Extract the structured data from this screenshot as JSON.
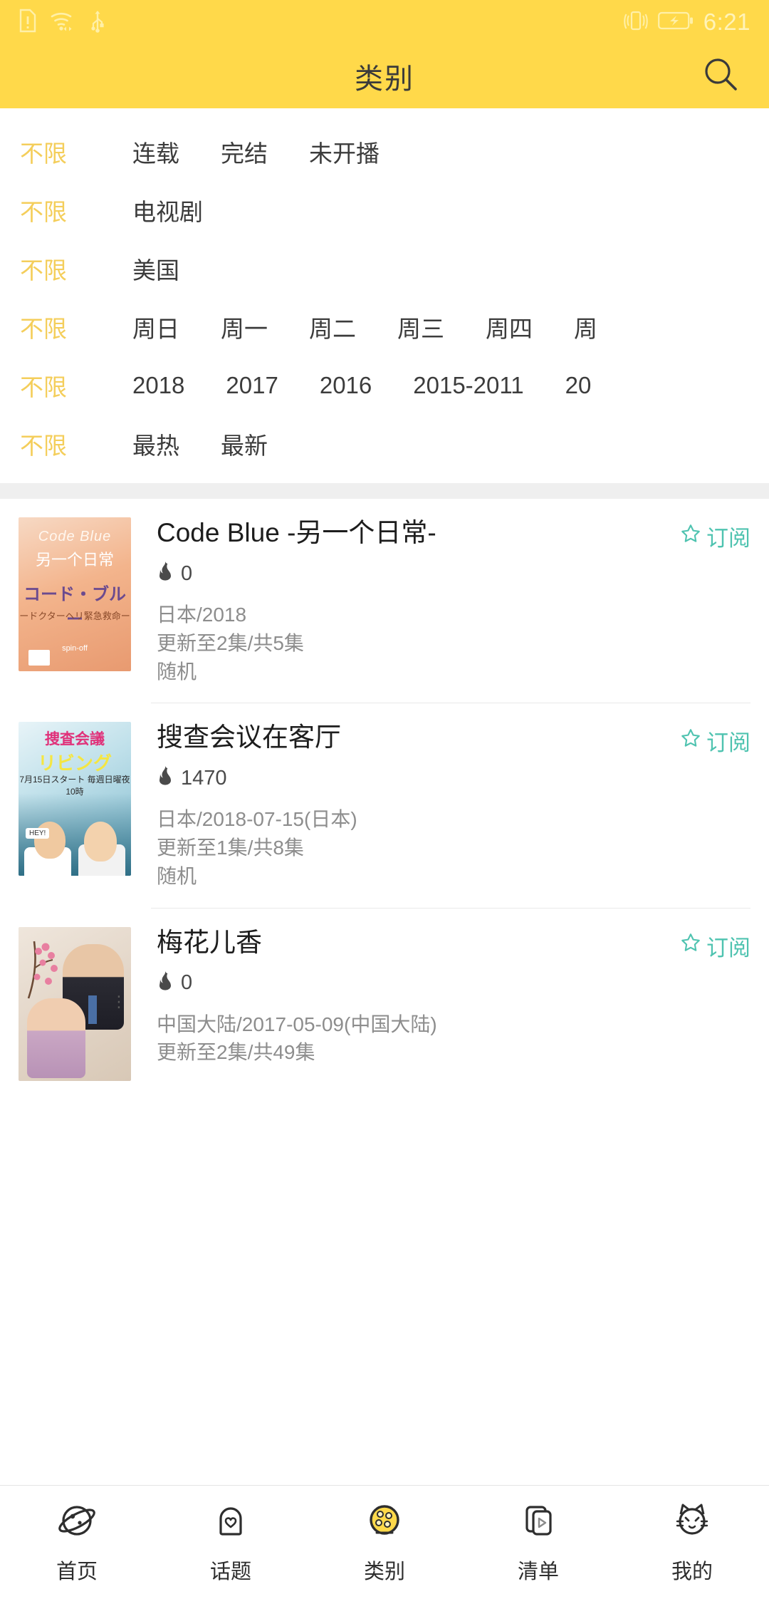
{
  "statusbar": {
    "time": "6:21",
    "icons": [
      "sim-alert-icon",
      "wifi-icon",
      "usb-icon",
      "vibrate-icon",
      "battery-charging-icon"
    ]
  },
  "header": {
    "title": "类别",
    "search_icon": "search-icon"
  },
  "filters": [
    {
      "name": "status",
      "options": [
        "不限",
        "连载",
        "完结",
        "未开播"
      ],
      "selected": 0
    },
    {
      "name": "type",
      "options": [
        "不限",
        "电视剧"
      ],
      "selected": 0
    },
    {
      "name": "region",
      "options": [
        "不限",
        "美国"
      ],
      "selected": 0
    },
    {
      "name": "weekday",
      "options": [
        "不限",
        "周日",
        "周一",
        "周二",
        "周三",
        "周四",
        "周"
      ],
      "selected": 0
    },
    {
      "name": "year",
      "options": [
        "不限",
        "2018",
        "2017",
        "2016",
        "2015-2011",
        "20"
      ],
      "selected": 0
    },
    {
      "name": "sort",
      "options": [
        "不限",
        "最热",
        "最新"
      ],
      "selected": 0
    }
  ],
  "list": [
    {
      "title": "Code Blue -另一个日常-",
      "heat_icon": "fire-icon",
      "heat": "0",
      "meta": [
        "日本/2018",
        "更新至2集/共5集",
        "随机"
      ],
      "subscribe_icon": "star-outline-icon",
      "subscribe_label": "订阅",
      "poster_name": "poster-code-blue"
    },
    {
      "title": "搜查会议在客厅",
      "heat_icon": "fire-icon",
      "heat": "1470",
      "meta": [
        "日本/2018-07-15(日本)",
        "更新至1集/共8集",
        "随机"
      ],
      "subscribe_icon": "star-outline-icon",
      "subscribe_label": "订阅",
      "poster_name": "poster-souba-kaigi"
    },
    {
      "title": "梅花儿香",
      "heat_icon": "fire-icon",
      "heat": "0",
      "meta": [
        "中国大陆/2017-05-09(中国大陆)",
        "更新至2集/共49集"
      ],
      "subscribe_icon": "star-outline-icon",
      "subscribe_label": "订阅",
      "poster_name": "poster-meihua"
    }
  ],
  "bottomnav": {
    "items": [
      {
        "label": "首页",
        "icon": "planet-icon",
        "active": false
      },
      {
        "label": "话题",
        "icon": "heart-icon",
        "active": false
      },
      {
        "label": "类别",
        "icon": "film-reel-icon",
        "active": true
      },
      {
        "label": "清单",
        "icon": "play-card-icon",
        "active": false
      },
      {
        "label": "我的",
        "icon": "cat-face-icon",
        "active": false
      }
    ]
  },
  "colors": {
    "brand_yellow": "#FFD94A",
    "accent_gold": "#F4CE5B",
    "subscribe_teal": "#4FC3B0",
    "text_dark": "#1d1d1d",
    "text_meta": "#8d8d8d"
  }
}
